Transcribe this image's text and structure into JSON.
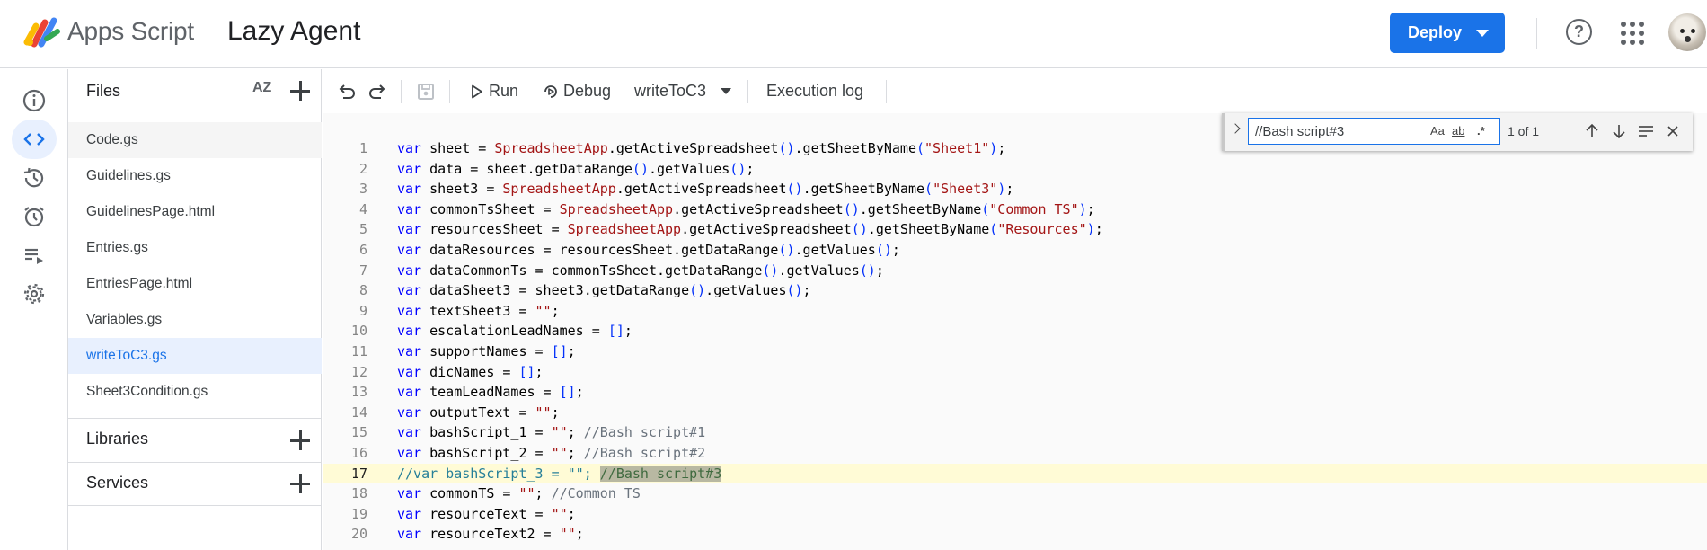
{
  "header": {
    "app_name": "Apps Script",
    "project_name": "Lazy Agent",
    "deploy_label": "Deploy",
    "help_glyph": "?"
  },
  "rail": {
    "items": [
      {
        "name": "info-icon",
        "active": false
      },
      {
        "name": "editor-icon",
        "active": true
      },
      {
        "name": "history-icon",
        "active": false
      },
      {
        "name": "triggers-icon",
        "active": false
      },
      {
        "name": "executions-icon",
        "active": false
      },
      {
        "name": "settings-icon",
        "active": false
      }
    ]
  },
  "files_panel": {
    "title": "Files",
    "sort_label": "AZ",
    "files": [
      {
        "name": "Code.gs",
        "state": "hover"
      },
      {
        "name": "Guidelines.gs",
        "state": ""
      },
      {
        "name": "GuidelinesPage.html",
        "state": ""
      },
      {
        "name": "Entries.gs",
        "state": ""
      },
      {
        "name": "EntriesPage.html",
        "state": ""
      },
      {
        "name": "Variables.gs",
        "state": ""
      },
      {
        "name": "writeToC3.gs",
        "state": "active"
      },
      {
        "name": "Sheet3Condition.gs",
        "state": ""
      }
    ],
    "libraries_label": "Libraries",
    "services_label": "Services"
  },
  "toolbar": {
    "run_label": "Run",
    "debug_label": "Debug",
    "function_name": "writeToC3",
    "execution_log_label": "Execution log"
  },
  "find": {
    "query": "//Bash script#3",
    "match_case": "Aa",
    "whole_word": "ab",
    "regex": ".*",
    "count": "1 of 1"
  },
  "editor": {
    "current_line": 17,
    "lines": [
      {
        "n": "1",
        "text": "var sheet = SpreadsheetApp.getActiveSpreadsheet().getSheetByName(\"Sheet1\");"
      },
      {
        "n": "2",
        "text": "var data = sheet.getDataRange().getValues();"
      },
      {
        "n": "3",
        "text": "var sheet3 = SpreadsheetApp.getActiveSpreadsheet().getSheetByName(\"Sheet3\");"
      },
      {
        "n": "4",
        "text": "var commonTsSheet = SpreadsheetApp.getActiveSpreadsheet().getSheetByName(\"Common TS\");"
      },
      {
        "n": "5",
        "text": "var resourcesSheet = SpreadsheetApp.getActiveSpreadsheet().getSheetByName(\"Resources\");"
      },
      {
        "n": "6",
        "text": "var dataResources = resourcesSheet.getDataRange().getValues();"
      },
      {
        "n": "7",
        "text": "var dataCommonTs = commonTsSheet.getDataRange().getValues();"
      },
      {
        "n": "8",
        "text": "var dataSheet3 = sheet3.getDataRange().getValues();"
      },
      {
        "n": "9",
        "text": "var textSheet3 = \"\";"
      },
      {
        "n": "10",
        "text": "var escalationLeadNames = [];"
      },
      {
        "n": "11",
        "text": "var supportNames = [];"
      },
      {
        "n": "12",
        "text": "var dicNames = [];"
      },
      {
        "n": "13",
        "text": "var teamLeadNames = [];"
      },
      {
        "n": "14",
        "text": "var outputText = \"\";"
      },
      {
        "n": "15",
        "text": "var bashScript_1 = \"\"; //Bash script#1"
      },
      {
        "n": "16",
        "text": "var bashScript_2 = \"\"; //Bash script#2"
      },
      {
        "n": "17",
        "text": "//var bashScript_3 = \"\"; //Bash script#3"
      },
      {
        "n": "18",
        "text": "var commonTS = \"\"; //Common TS"
      },
      {
        "n": "19",
        "text": "var resourceText = \"\";"
      },
      {
        "n": "20",
        "text": "var resourceText2 = \"\";"
      }
    ]
  },
  "colors": {
    "accent": "#1a73e8",
    "keyword": "#0000ff",
    "string": "#a31515",
    "current_line": "#fffbd6",
    "find_match": "#b8b8a2"
  }
}
